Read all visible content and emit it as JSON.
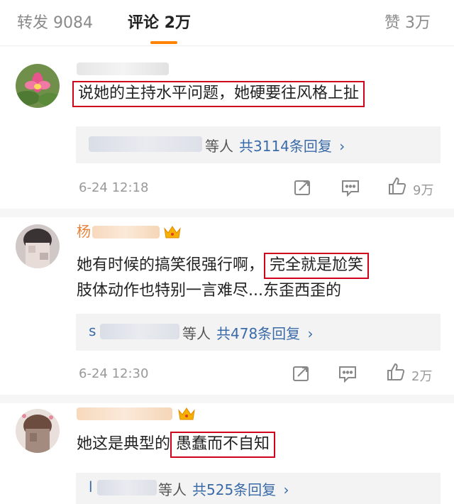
{
  "tabs": {
    "repost": "转发 9084",
    "comments": "评论 2万",
    "likes": "赞 3万"
  },
  "colors": {
    "accent": "#ff8200",
    "highlight_box": "#d0021b",
    "link": "#3a6ba8"
  },
  "comments": [
    {
      "text_before": "",
      "text_highlight": "说她的主持水平问题，她硬要往风格上扯",
      "reply_who": "等人",
      "reply_count": "共3114条回复",
      "time": "6-24 12:18",
      "likes": "9万"
    },
    {
      "text_before": "她有时候的搞笑很强行啊，",
      "text_highlight": "完全就是尬笑",
      "text_line2": "肢体动作也特别一言难尽...东歪西歪的",
      "reply_prefix": "s",
      "reply_who": "等人",
      "reply_count": "共478条回复",
      "time": "6-24 12:30",
      "likes": "2万",
      "name_prefix": "杨"
    },
    {
      "text_before": "她这是典型的",
      "text_highlight": "愚蠢而不自知",
      "reply_prefix": "l",
      "reply_who": "等人",
      "reply_count": "共525条回复"
    }
  ],
  "icons": {
    "chevron": "›",
    "share": "share-icon",
    "comment": "comment-icon",
    "like": "thumbs-up-icon",
    "crown": "crown-icon"
  }
}
